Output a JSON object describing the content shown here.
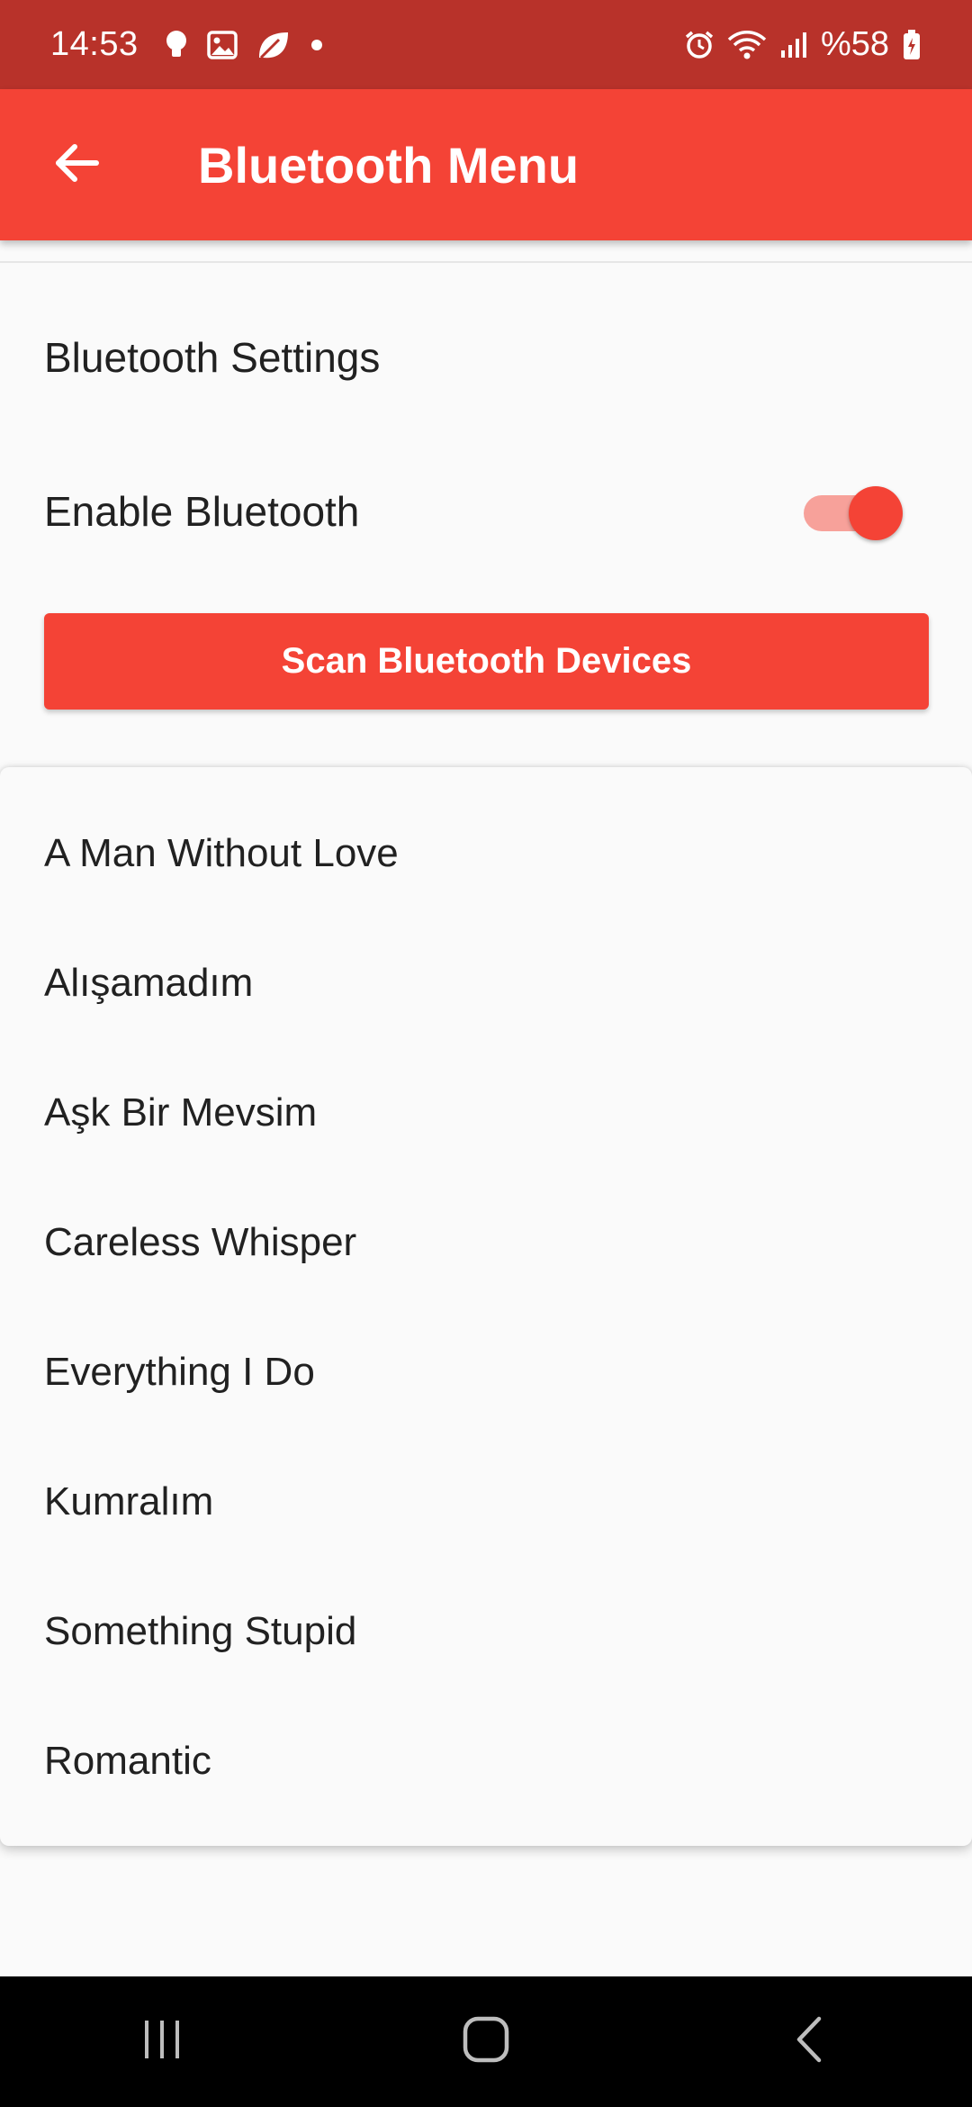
{
  "status_bar": {
    "time": "14:53",
    "battery": "%58",
    "left_icons": [
      "bulb-icon",
      "image-icon",
      "leaf-icon",
      "dot-icon"
    ],
    "right_icons": [
      "alarm-icon",
      "wifi-icon",
      "signal-icon",
      "battery-icon"
    ]
  },
  "app_bar": {
    "title": "Bluetooth Menu",
    "back_icon": "arrow-back-icon",
    "color": "#f44336"
  },
  "settings": {
    "heading": "Bluetooth Settings",
    "enable_label": "Enable Bluetooth",
    "enabled": true,
    "scan_button_label": "Scan Bluetooth Devices"
  },
  "songs": [
    "A Man Without Love",
    "Alışamadım",
    "Aşk Bir Mevsim",
    "Careless Whisper",
    "Everything I Do",
    "Kumralım",
    "Something Stupid",
    "Romantic"
  ],
  "nav_bar": {
    "icons": [
      "recents-icon",
      "home-icon",
      "back-icon"
    ]
  },
  "colors": {
    "status_bar": "#b8322a",
    "accent": "#f44336",
    "toggle_track": "#f7a19a",
    "background": "#fafafa"
  }
}
